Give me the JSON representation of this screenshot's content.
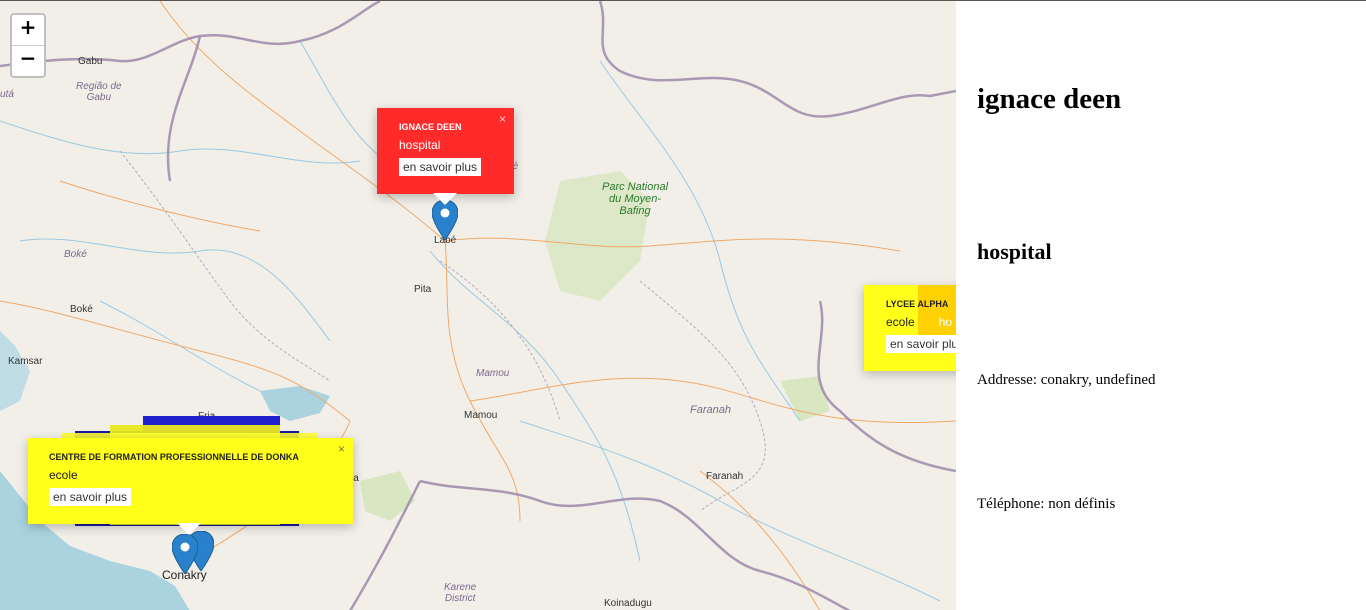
{
  "map": {
    "zoom_in": "+",
    "zoom_out": "−",
    "labels": {
      "gabu": "Gabu",
      "regiao": "Região de\nGabu",
      "uta": "utá",
      "boke_region": "Boké",
      "boke_city": "Boké",
      "kamsar": "Kamsar",
      "labe": "Labé",
      "labe_region": "Labé",
      "pita": "Pita",
      "mamou_region": "Mamou",
      "mamou_city": "Mamou",
      "park": "Parc National\ndu Moyen-\nBafing",
      "faranah_region": "Faranah",
      "faranah_city": "Faranah",
      "kindia": "Kindia",
      "fria": "Fria",
      "conakry": "Conakry",
      "karene": "Karene\nDistrict",
      "koinadugu": "Koinadugu"
    },
    "colors": {
      "land": "#f2efe9",
      "water": "#aad3df",
      "border": "#9e8aaa",
      "road": "#f0a868",
      "park": "#cde3b0"
    }
  },
  "popups": {
    "ignace": {
      "title": "IGNACE DEEN",
      "category": "hospital",
      "button": "en savoir plus",
      "close": "×",
      "color": "#ff2a2a"
    },
    "lycee": {
      "title": "LYCEE ALPHA",
      "category": "ecole",
      "button": "en savoir plus",
      "extra": "ho",
      "color": "#ffff1a"
    },
    "donka": {
      "title": "CENTRE DE FORMATION PROFESSIONNELLE DE DONKA",
      "category": "ecole",
      "button": "en savoir plus",
      "close": "×",
      "color": "#ffff1a"
    },
    "stack_ghost_category": "ecole",
    "stack_ghost_button": "plus"
  },
  "details": {
    "name": "ignace deen",
    "category": "hospital",
    "address": "Addresse: conakry, undefined",
    "phone": "Téléphone: non définis"
  }
}
